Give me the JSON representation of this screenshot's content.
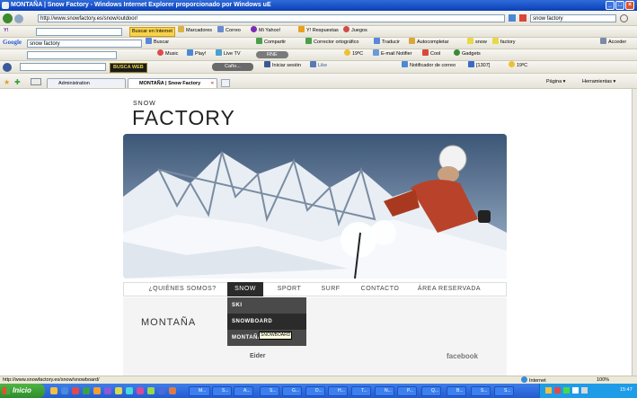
{
  "window": {
    "title": "MONTAÑA | Snow Factory - Windows Internet Explorer proporcionado por Windows uE"
  },
  "address": {
    "url": "http://www.snowfactory.es/snow/outdoor/",
    "search": "snow factory"
  },
  "yahoo_bar": {
    "logo": "Y!",
    "search_button": "Buscar en Internet",
    "items": [
      "Marcadores",
      "Correo",
      "Mi Yahoo!",
      "Y! Respuestas",
      "Juegos"
    ]
  },
  "google_bar": {
    "logo": "Google",
    "search": "snow factory",
    "search_button": "Buscar",
    "items": [
      "Compartir",
      "Corrector ortográfico",
      "Traducir",
      "Autocompletar",
      "snow",
      "factory"
    ],
    "signin": "Acceder"
  },
  "toolbar3": {
    "items": [
      "Music",
      "Play!",
      "Live TV",
      "RNE",
      "19ºC",
      "E-mail Notifier",
      "Cool",
      "Gadgets"
    ]
  },
  "toolbar4": {
    "logo": "BUSCA WEB",
    "radio": "Caño...",
    "items": [
      "Iniciar sesión",
      "Like",
      "Notificador de correo",
      "[1307]",
      "19ºC"
    ]
  },
  "tabs": [
    {
      "label": "Administration"
    },
    {
      "label": "MONTAÑA | Snow Factory"
    }
  ],
  "commandbar": {
    "items": [
      "Página",
      "Herramientas"
    ]
  },
  "site": {
    "logo_small": "SNOW",
    "logo_big": "FACTORY",
    "nav": [
      {
        "label": "¿QUIÉNES SOMOS?"
      },
      {
        "label": "SNOW"
      },
      {
        "label": "SPORT"
      },
      {
        "label": "SURF"
      },
      {
        "label": "CONTACTO"
      },
      {
        "label": "ÁREA RESERVADA"
      }
    ],
    "dropdown": [
      {
        "label": "SKI"
      },
      {
        "label": "SNOWBOARD"
      },
      {
        "label": "MONTAÑA"
      }
    ],
    "tooltip": "SNOWBOARD",
    "page_heading": "MONTAÑA",
    "footer_name": "Eider",
    "footer_social": "facebook"
  },
  "statusbar": {
    "url": "http://www.snowfactory.es/snow/snowboard/",
    "zone": "Internet",
    "zoom": "100%"
  },
  "taskbar": {
    "start": "Inicio",
    "tasks": [
      "M...",
      "S...",
      "A...",
      "S...",
      "G...",
      "D...",
      "H...",
      "T...",
      "N...",
      "P...",
      "Q...",
      "B...",
      "S...",
      "S..."
    ],
    "clock": "15:47"
  },
  "colors": {
    "titlebar": "#0a3fb8",
    "nav_active": "#2b2b2b",
    "taskbar": "#235bd2",
    "start": "#2e8d2a"
  }
}
